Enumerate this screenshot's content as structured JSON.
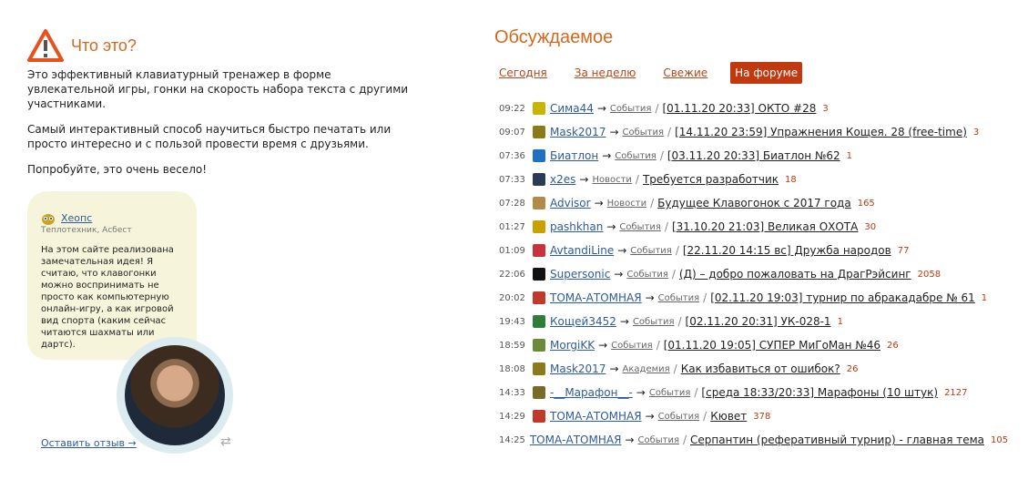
{
  "about": {
    "title": "Что это?",
    "paragraphs": [
      "Это эффективный клавиатурный тренажер в форме увлекательной игры, гонки на скорость набора текста с другими участниками.",
      "Самый интерактивный способ научиться быстро печатать или просто интересно и с пользой провести время с друзьями.",
      "Попробуйте, это очень весело!"
    ]
  },
  "review": {
    "author": "Хеопс",
    "author_sub": "Теплотехник, Асбест",
    "text": "На этом сайте реализована замечательная идея! Я считаю, что клавогонки можно воспринимать не просто как компьютерную онлайн-игру, а как игровой вид спорта (каким сейчас читаются шахматы или дартс).",
    "leave_link": "Оставить отзыв →"
  },
  "discussed": {
    "title": "Обсуждаемое",
    "tabs": [
      "Сегодня",
      "За неделю",
      "Свежие",
      "На форуме"
    ],
    "active_tab": 3,
    "rows": [
      {
        "time": "09:22",
        "user": "Сима44",
        "section": "События",
        "topic": "[01.11.20 20:33] ОКТО #28",
        "count": "3",
        "avatar_color": "#c9b400"
      },
      {
        "time": "09:07",
        "user": "Mask2017",
        "section": "События",
        "topic": "[14.11.20 23:59] Упражнения Кощея. 28 (free-time)",
        "count": "3",
        "avatar_color": "#8a7a1a"
      },
      {
        "time": "07:36",
        "user": "Биатлон",
        "section": "События",
        "topic": "[03.11.20 20:33] Биатлон №62",
        "count": "1",
        "avatar_color": "#1f6fc2"
      },
      {
        "time": "07:33",
        "user": "x2es",
        "section": "Новости",
        "topic": "Требуется разработчик",
        "count": "18",
        "avatar_color": "#2b3b55"
      },
      {
        "time": "07:28",
        "user": "Advisor",
        "section": "Новости",
        "topic": "Будущее Клавогонок с 2017 года",
        "count": "165",
        "avatar_color": "#b48a4a"
      },
      {
        "time": "01:27",
        "user": "pashkhan",
        "section": "События",
        "topic": "[31.10.20 21:03] Великая ОХОТА",
        "count": "30",
        "avatar_color": "#c9a000"
      },
      {
        "time": "01:09",
        "user": "AvtandiLine",
        "section": "События",
        "topic": "[22.11.20 14:15 вс] Дружба народов",
        "count": "77",
        "avatar_color": "#c8323c"
      },
      {
        "time": "22:06",
        "user": "Supersonic",
        "section": "События",
        "topic": "(Д) – добро пожаловать на ДрагРэйсинг",
        "count": "2058",
        "avatar_color": "#111111"
      },
      {
        "time": "20:02",
        "user": "ТОМА-АТОМНАЯ",
        "section": "События",
        "topic": "[02.11.20 19:03] турнир по абракадабре № 61",
        "count": "1",
        "avatar_color": "#c0392b"
      },
      {
        "time": "19:43",
        "user": "Кощей3452",
        "section": "События",
        "topic": "[02.11.20 20:31] УК-028-1",
        "count": "1",
        "avatar_color": "#2f7d3a"
      },
      {
        "time": "18:59",
        "user": "MorgiKK",
        "section": "События",
        "topic": "[01.11.20 19:05] СУПЕР МиГоМан №46",
        "count": "26",
        "avatar_color": "#6a8a3a"
      },
      {
        "time": "18:08",
        "user": "Mask2017",
        "section": "Академия",
        "topic": "Как избавиться от ошибок?",
        "count": "26",
        "avatar_color": "#8a7a1a"
      },
      {
        "time": "14:33",
        "user": "-__Марафон__-",
        "section": "События",
        "topic": "[среда 18:33/20:33] Марафоны (10 штук)",
        "count": "2127",
        "avatar_color": "#7a6a2a"
      },
      {
        "time": "14:29",
        "user": "ТОМА-АТОМНАЯ",
        "section": "События",
        "topic": "Кювет",
        "count": "378",
        "avatar_color": "#c0392b"
      },
      {
        "time": "14:25",
        "user": "ТОМА-АТОМНАЯ",
        "section": "События",
        "topic": "Серпантин (реферативный турнир) - главная тема",
        "count": "105",
        "avatar_color": "#c0392b"
      }
    ]
  },
  "colors": {
    "accent": "#d2691e",
    "active_tab_bg": "#c0390f",
    "link_blue": "#2e5b9a",
    "bubble_bg": "#f6f5dc"
  },
  "icons": {
    "warning": "warning-triangle-icon",
    "owl": "owl-icon",
    "refresh": "refresh-icon"
  }
}
